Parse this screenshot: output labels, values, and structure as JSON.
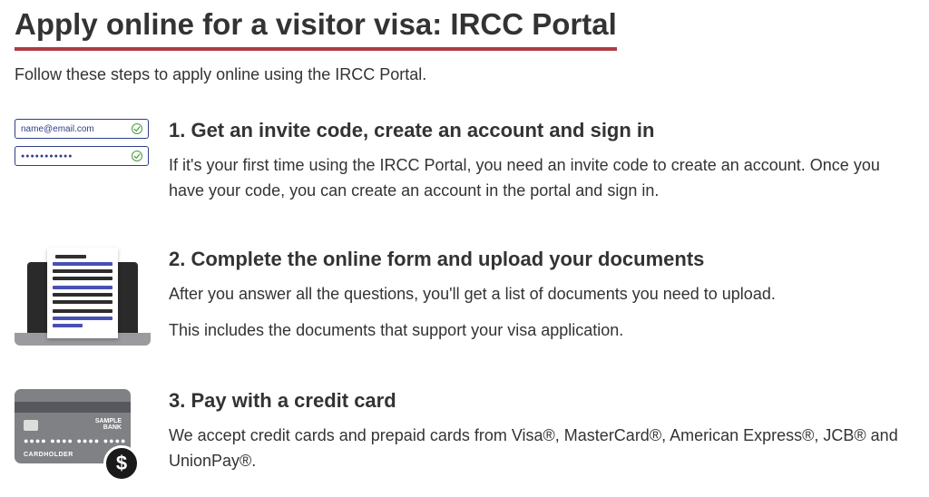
{
  "title": "Apply online for a visitor visa: IRCC Portal",
  "intro": "Follow these steps to apply online using the IRCC Portal.",
  "step1": {
    "heading": "1. Get an invite code, create an account and sign in",
    "body": "If it's your first time using the IRCC Portal, you need an invite code to create an account. Once you have your code, you can create an account in the portal and sign in.",
    "icon": {
      "email_placeholder": "name@email.com",
      "password_mask": "●●●●●●●●●●●"
    }
  },
  "step2": {
    "heading": "2. Complete the online form and upload your documents",
    "body_a": "After you answer all the questions, you'll get a list of documents you need to upload.",
    "body_b": "This includes the documents that support your visa application."
  },
  "step3": {
    "heading": "3. Pay with a credit card",
    "body": "We accept credit cards and prepaid cards from Visa®, MasterCard®, American Express®, JCB® and UnionPay®.",
    "card": {
      "bank_line1": "SAMPLE",
      "bank_line2": "BANK",
      "number_mask": "●●●●  ●●●●  ●●●●  ●●●●",
      "holder": "CARDHOLDER",
      "dollar": "$"
    }
  }
}
